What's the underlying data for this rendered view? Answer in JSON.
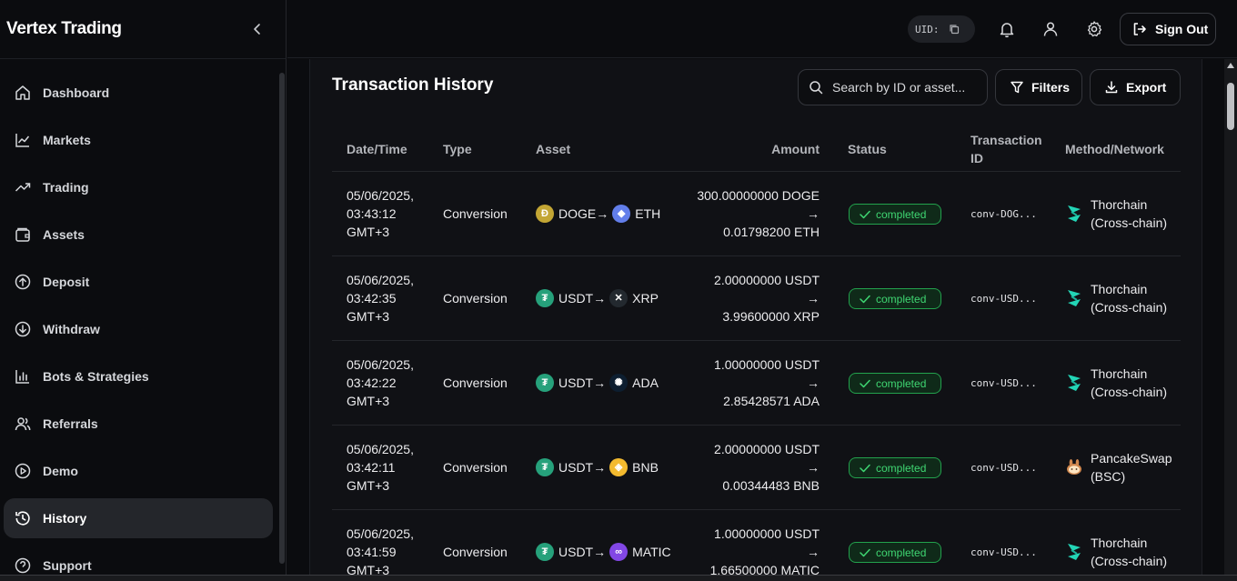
{
  "app": {
    "title": "Vertex Trading"
  },
  "sidebar": {
    "items": [
      {
        "label": "Dashboard",
        "icon": "home-icon"
      },
      {
        "label": "Markets",
        "icon": "line-chart-icon"
      },
      {
        "label": "Trading",
        "icon": "trending-up-icon"
      },
      {
        "label": "Assets",
        "icon": "wallet-icon"
      },
      {
        "label": "Deposit",
        "icon": "arrow-up-circle-icon"
      },
      {
        "label": "Withdraw",
        "icon": "arrow-down-circle-icon"
      },
      {
        "label": "Bots & Strategies",
        "icon": "bar-chart-icon"
      },
      {
        "label": "Referrals",
        "icon": "users-icon"
      },
      {
        "label": "Demo",
        "icon": "play-circle-icon"
      },
      {
        "label": "History",
        "icon": "history-icon",
        "active": true
      },
      {
        "label": "Support",
        "icon": "help-circle-icon"
      }
    ]
  },
  "header": {
    "uid_label": "UID:",
    "sign_out_label": "Sign Out"
  },
  "page": {
    "title": "Transaction History",
    "search_placeholder": "Search by ID or asset...",
    "filters_label": "Filters",
    "export_label": "Export"
  },
  "table": {
    "columns": [
      "Date/Time",
      "Type",
      "Asset",
      "Amount",
      "Status",
      "Transaction ID",
      "Method/Network"
    ],
    "rows": [
      {
        "date": "05/06/2025, 03:43:12 GMT+3",
        "type": "Conversion",
        "from": "DOGE",
        "to": "ETH",
        "from_color": "#c3a634",
        "to_color": "#627eea",
        "amount_from": "300.00000000 DOGE",
        "arrow": "→",
        "amount_to": "0.01798200 ETH",
        "status": "completed",
        "txid": "conv-DOG...",
        "method": "Thorchain (Cross-chain)",
        "method_icon": "thorchain-icon"
      },
      {
        "date": "05/06/2025, 03:42:35 GMT+3",
        "type": "Conversion",
        "from": "USDT",
        "to": "XRP",
        "from_color": "#26a17b",
        "to_color": "#23292f",
        "amount_from": "2.00000000 USDT",
        "arrow": "→",
        "amount_to": "3.99600000 XRP",
        "status": "completed",
        "txid": "conv-USD...",
        "method": "Thorchain (Cross-chain)",
        "method_icon": "thorchain-icon"
      },
      {
        "date": "05/06/2025, 03:42:22 GMT+3",
        "type": "Conversion",
        "from": "USDT",
        "to": "ADA",
        "from_color": "#26a17b",
        "to_color": "#0d1e30",
        "amount_from": "1.00000000 USDT",
        "arrow": "→",
        "amount_to": "2.85428571 ADA",
        "status": "completed",
        "txid": "conv-USD...",
        "method": "Thorchain (Cross-chain)",
        "method_icon": "thorchain-icon"
      },
      {
        "date": "05/06/2025, 03:42:11 GMT+3",
        "type": "Conversion",
        "from": "USDT",
        "to": "BNB",
        "from_color": "#26a17b",
        "to_color": "#f3ba2f",
        "amount_from": "2.00000000 USDT",
        "arrow": "→",
        "amount_to": "0.00344483 BNB",
        "status": "completed",
        "txid": "conv-USD...",
        "method": "PancakeSwap (BSC)",
        "method_icon": "pancakeswap-icon"
      },
      {
        "date": "05/06/2025, 03:41:59 GMT+3",
        "type": "Conversion",
        "from": "USDT",
        "to": "MATIC",
        "from_color": "#26a17b",
        "to_color": "#8247e5",
        "amount_from": "1.00000000 USDT",
        "arrow": "→",
        "amount_to": "1.66500000 MATIC",
        "status": "completed",
        "txid": "conv-USD...",
        "method": "Thorchain (Cross-chain)",
        "method_icon": "thorchain-icon"
      }
    ]
  },
  "colors": {
    "background": "#0b0c0f",
    "panel": "#101115",
    "status_green": "#3fd672",
    "thorchain": "#23d5b6"
  }
}
